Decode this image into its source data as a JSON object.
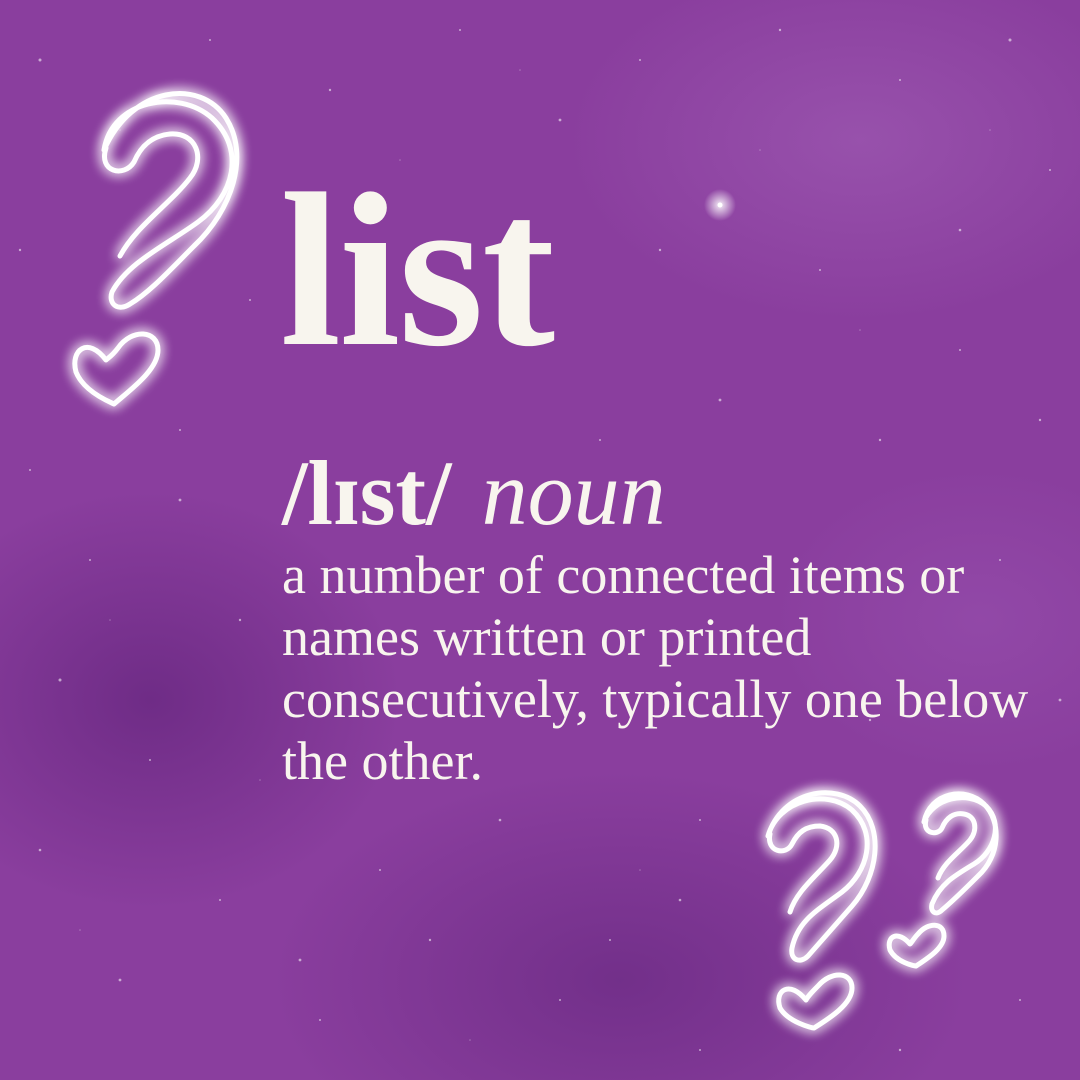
{
  "entry": {
    "word": "list",
    "pronunciation": "/lɪst/",
    "part_of_speech": "noun",
    "definition": "a number of connected items or names written or printed consecutively, typically one below the other."
  },
  "colors": {
    "background": "#8a3e9e",
    "text": "#f8f5ee",
    "neon": "#ffffff"
  },
  "decorations": [
    {
      "icon": "question-heart-icon",
      "count": 3
    }
  ]
}
